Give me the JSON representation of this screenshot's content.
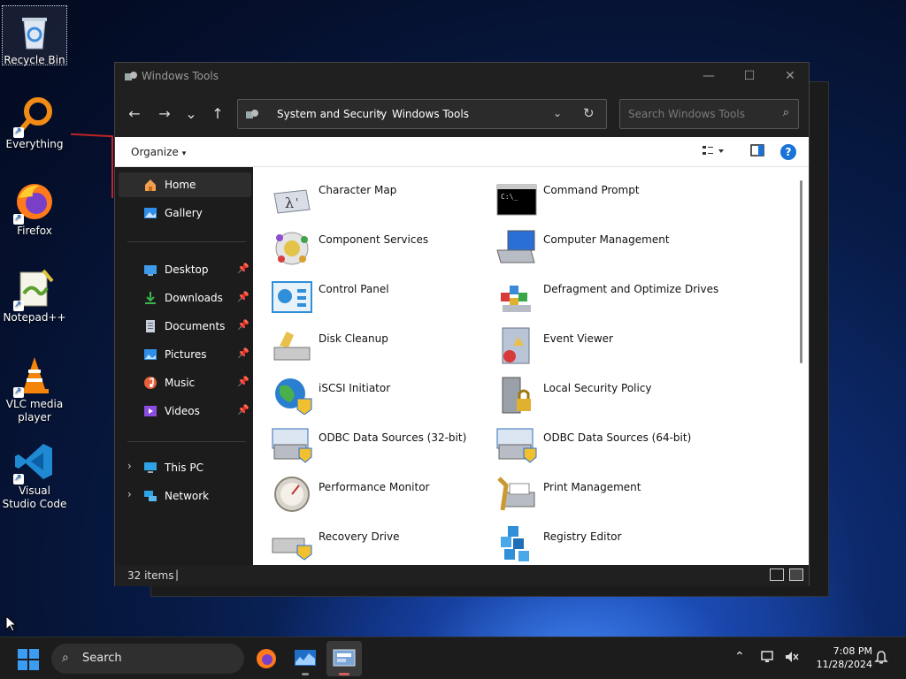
{
  "desktop": {
    "icons": [
      {
        "label": "Recycle Bin",
        "icon": "recycle-bin-icon"
      },
      {
        "label": "Everything",
        "icon": "everything-search-icon"
      },
      {
        "label": "Firefox",
        "icon": "firefox-icon"
      },
      {
        "label": "Notepad++",
        "icon": "notepad-plus-plus-icon"
      },
      {
        "label": "VLC media player",
        "icon": "vlc-cone-icon"
      },
      {
        "label": "Visual Studio Code",
        "icon": "vscode-icon"
      }
    ]
  },
  "window": {
    "title": "Windows Tools",
    "controls": {
      "minimize": "—",
      "maximize": "☐",
      "close": "✕"
    },
    "nav": {
      "back": "←",
      "forward": "→",
      "recent": "⌄",
      "up": "↑"
    },
    "address": {
      "crumbs": [
        "System and Security",
        "Windows Tools"
      ],
      "separator": "›",
      "dropdown": "⌄",
      "refresh": "↻"
    },
    "search": {
      "placeholder": "Search Windows Tools",
      "icon": "⌕"
    },
    "commandbar": {
      "organize": "Organize",
      "caret": "▾",
      "help": "?"
    },
    "navpane": {
      "top": [
        {
          "label": "Home",
          "icon": "home-icon",
          "active": true
        },
        {
          "label": "Gallery",
          "icon": "gallery-icon"
        }
      ],
      "quick": [
        {
          "label": "Desktop",
          "icon": "desktop-folder-icon"
        },
        {
          "label": "Downloads",
          "icon": "downloads-folder-icon"
        },
        {
          "label": "Documents",
          "icon": "documents-folder-icon"
        },
        {
          "label": "Pictures",
          "icon": "pictures-folder-icon"
        },
        {
          "label": "Music",
          "icon": "music-folder-icon"
        },
        {
          "label": "Videos",
          "icon": "videos-folder-icon"
        }
      ],
      "pin": "📌",
      "tree": [
        {
          "label": "This PC",
          "icon": "this-pc-icon",
          "expander": "›"
        },
        {
          "label": "Network",
          "icon": "network-icon",
          "expander": "›"
        }
      ]
    },
    "items": [
      {
        "label": "Character Map",
        "icon": "character-map-icon"
      },
      {
        "label": "Command Prompt",
        "icon": "command-prompt-icon"
      },
      {
        "label": "Component Services",
        "icon": "component-services-icon"
      },
      {
        "label": "Computer Management",
        "icon": "computer-management-icon"
      },
      {
        "label": "Control Panel",
        "icon": "control-panel-icon"
      },
      {
        "label": "Defragment and Optimize Drives",
        "icon": "defragment-icon"
      },
      {
        "label": "Disk Cleanup",
        "icon": "disk-cleanup-icon"
      },
      {
        "label": "Event Viewer",
        "icon": "event-viewer-icon"
      },
      {
        "label": "iSCSI Initiator",
        "icon": "iscsi-initiator-icon"
      },
      {
        "label": "Local Security Policy",
        "icon": "local-security-policy-icon"
      },
      {
        "label": "ODBC Data Sources (32-bit)",
        "icon": "odbc-32-icon"
      },
      {
        "label": "ODBC Data Sources (64-bit)",
        "icon": "odbc-64-icon"
      },
      {
        "label": "Performance Monitor",
        "icon": "performance-monitor-icon"
      },
      {
        "label": "Print Management",
        "icon": "print-management-icon"
      },
      {
        "label": "Recovery Drive",
        "icon": "recovery-drive-icon"
      },
      {
        "label": "Registry Editor",
        "icon": "registry-editor-icon"
      }
    ],
    "status": {
      "count": "32 items",
      "divider": "|"
    }
  },
  "taskbar": {
    "search_label": "Search",
    "search_icon": "⌕",
    "tray": {
      "chevron": "⌃"
    },
    "clock": {
      "time": "7:08 PM",
      "date": "11/28/2024"
    }
  },
  "colors": {
    "accent": "#1a73d8",
    "window_bg": "#202020",
    "content_bg": "#ffffff"
  }
}
